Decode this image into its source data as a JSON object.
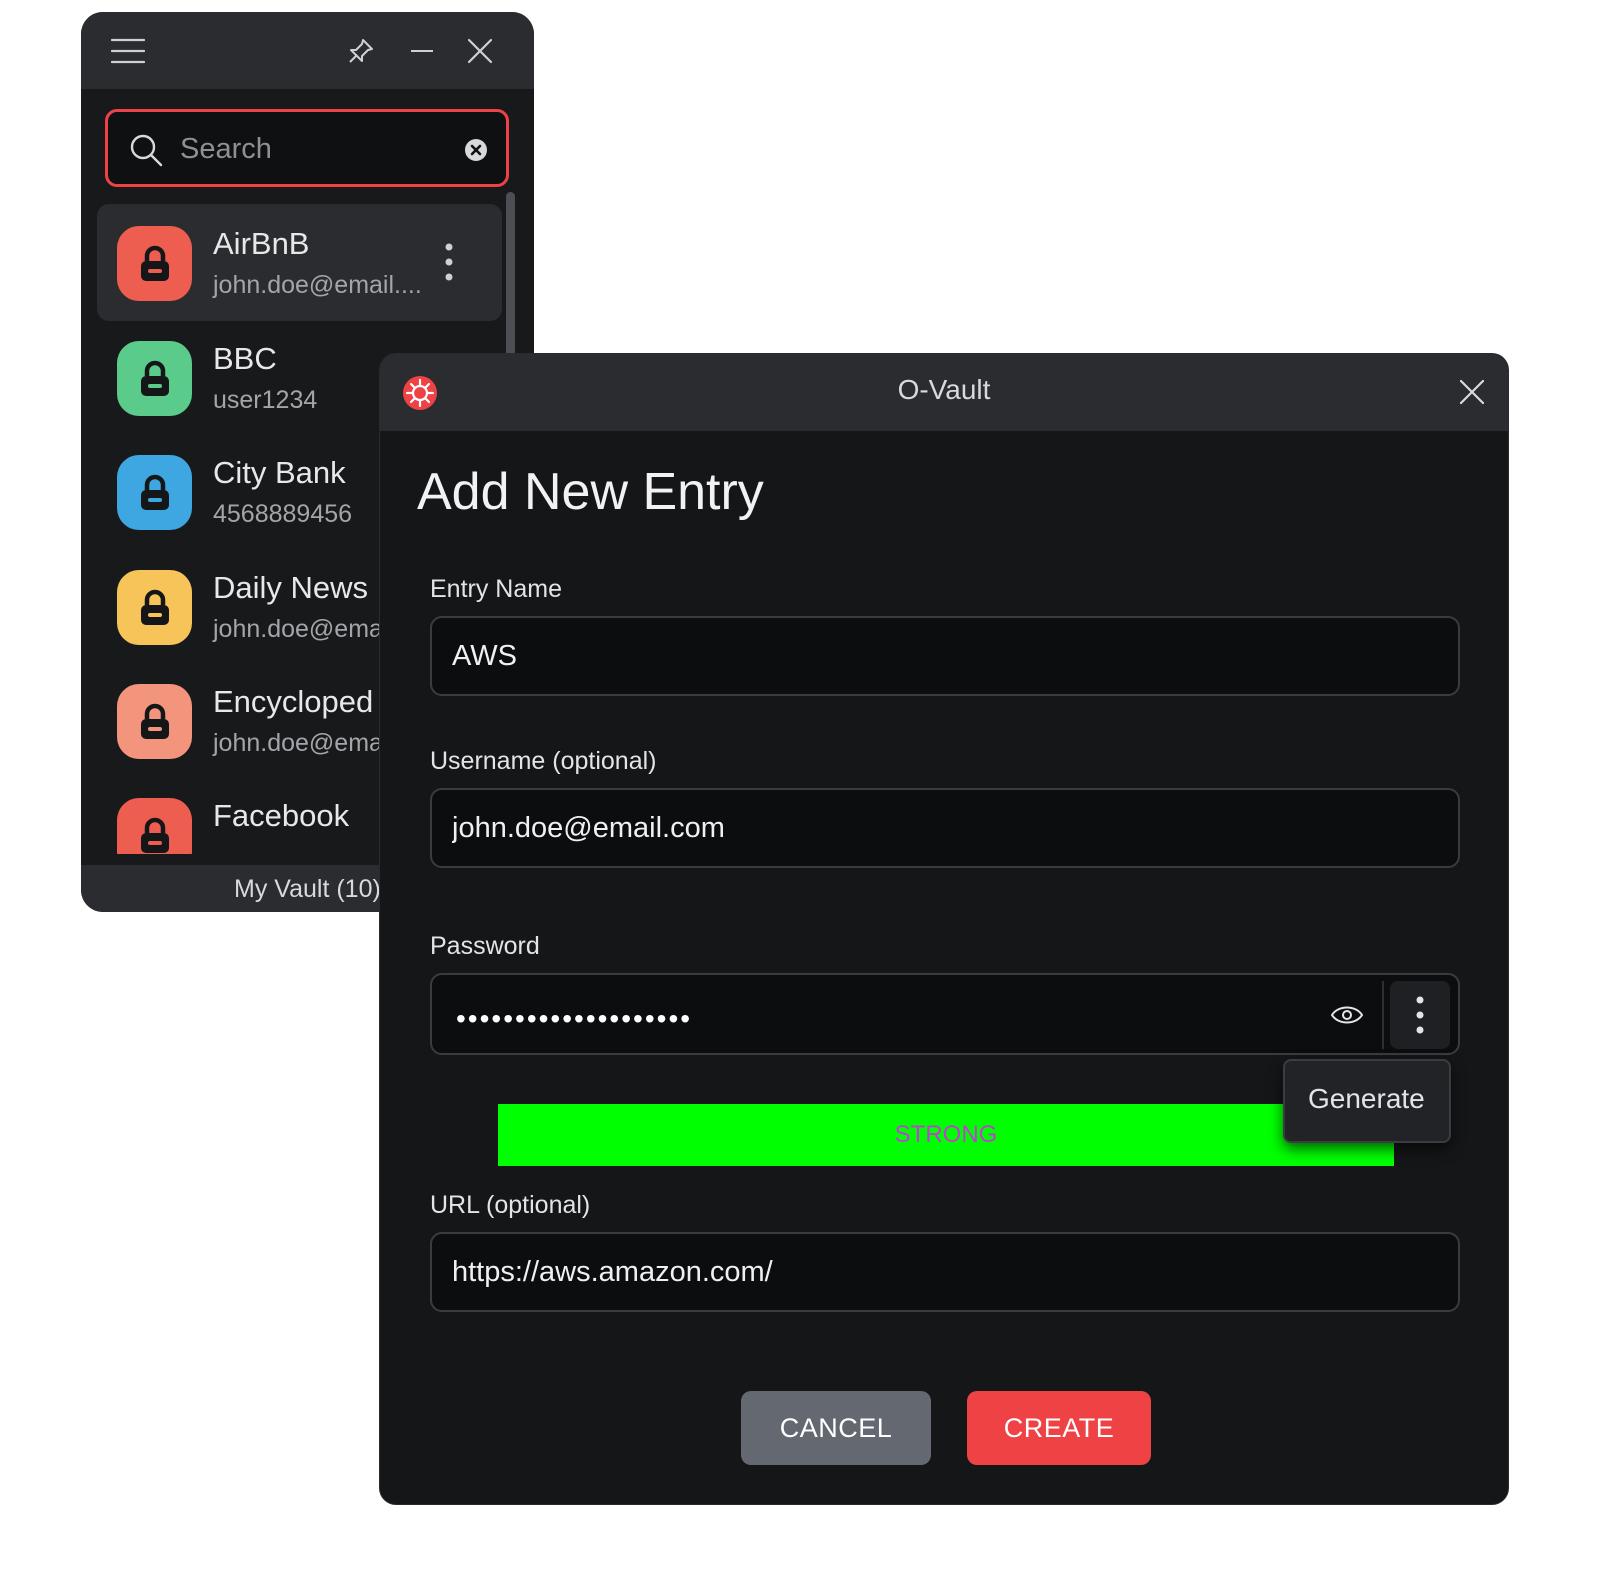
{
  "vault": {
    "search": {
      "placeholder": "Search",
      "value": ""
    },
    "entries": [
      {
        "name": "AirBnB",
        "subtitle": "john.doe@email....",
        "color": "#ee5e50",
        "selected": true
      },
      {
        "name": "BBC",
        "subtitle": "user1234",
        "color": "#5acb8b"
      },
      {
        "name": "City Bank",
        "subtitle": "4568889456",
        "color": "#3ea6e0"
      },
      {
        "name": "Daily News",
        "subtitle": "john.doe@ema",
        "color": "#f7c45a"
      },
      {
        "name": "Encycloped",
        "subtitle": "john.doe@ema",
        "color": "#f2957c"
      },
      {
        "name": "Facebook",
        "subtitle": "",
        "color": "#ee5e50"
      }
    ],
    "footer": "My Vault (10)"
  },
  "dialog": {
    "title": "O-Vault",
    "heading": "Add New Entry",
    "entry_name": {
      "label": "Entry Name",
      "value": "AWS"
    },
    "username": {
      "label": "Username (optional)",
      "value": "john.doe@email.com"
    },
    "password": {
      "label": "Password",
      "masked": "••••••••••••••••••••"
    },
    "strength": {
      "label": "STRONG",
      "color": "#00ff00"
    },
    "generate_menu": {
      "item": "Generate"
    },
    "url": {
      "label": "URL (optional)",
      "value": "https://aws.amazon.com/"
    },
    "cancel_label": "CANCEL",
    "create_label": "CREATE"
  },
  "colors": {
    "accent": "#ef4244",
    "search_border": "#ee4248"
  }
}
